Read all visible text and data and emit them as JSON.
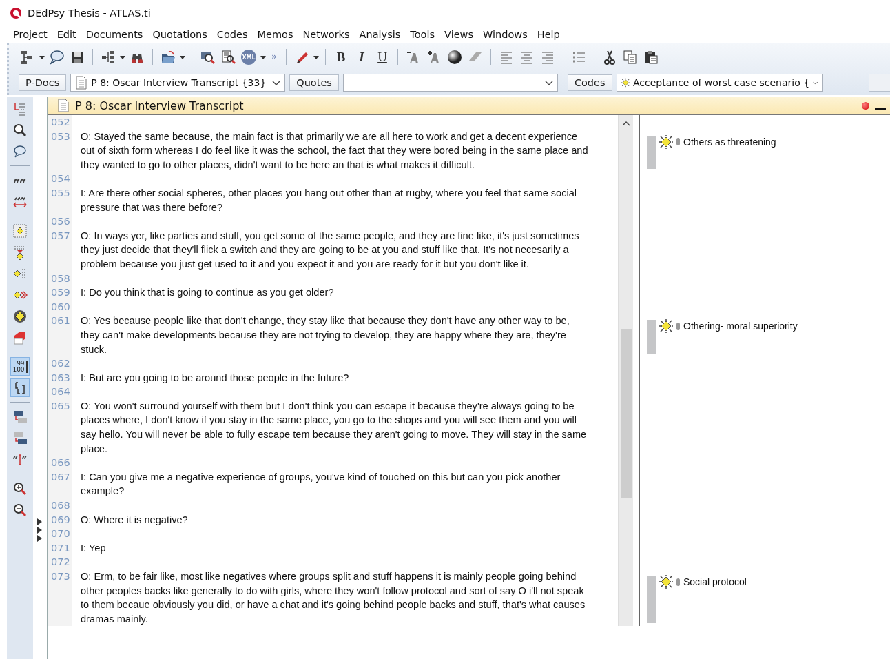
{
  "window": {
    "title": "DEdPsy Thesis - ATLAS.ti"
  },
  "menu": [
    "Project",
    "Edit",
    "Documents",
    "Quotations",
    "Codes",
    "Memos",
    "Networks",
    "Analysis",
    "Tools",
    "Views",
    "Windows",
    "Help"
  ],
  "toolbar": {
    "xml": "XML",
    "overflow": "»",
    "bold": "B",
    "italic": "I",
    "underline": "U"
  },
  "selectors": [
    {
      "kind": "button",
      "label": "P-Docs"
    },
    {
      "kind": "doc-combo",
      "value": "P 8: Oscar Interview Transcript {33}"
    },
    {
      "kind": "button",
      "label": "Quotes"
    },
    {
      "kind": "combo"
    },
    {
      "kind": "button",
      "label": "Codes"
    },
    {
      "kind": "code-combo",
      "value": "Acceptance of worst case scenario {"
    },
    {
      "kind": "stub"
    }
  ],
  "side_tools": [
    {
      "pressed": false
    },
    {
      "pressed": false
    },
    {
      "pressed": false
    },
    {
      "pressed": false
    },
    {
      "pressed": false
    },
    {
      "pressed": false
    },
    {
      "pressed": false
    },
    {
      "pressed": false
    },
    {
      "pressed": false
    },
    {
      "pressed": false
    },
    {
      "pressed": false
    },
    {
      "pressed": true,
      "label": [
        "99",
        "100"
      ]
    },
    {
      "pressed": true
    },
    {
      "pressed": false
    },
    {
      "pressed": false
    },
    {
      "pressed": false
    },
    {
      "pressed": false
    },
    {
      "pressed": false
    }
  ],
  "document": {
    "title": "P 8: Oscar Interview Transcript",
    "lines": [
      {
        "number": "052"
      },
      {
        "number": "053",
        "text": "O: Stayed the same because, the main fact is that primarily we are all here to work and get a decent experience out of sixth form whereas I do feel like it was the school, the fact that they were bored being in the same place and they wanted to go to other places, didn't want to be here an that is what makes it difficult.",
        "code": "Others as threatening"
      },
      {
        "number": "054"
      },
      {
        "number": "055",
        "text": "I: Are there other social spheres, other places you hang out other than at rugby, where you feel that same social pressure that was there before?"
      },
      {
        "number": "056"
      },
      {
        "number": "057",
        "text": "O: In ways yer, like parties and stuff, you get some of the same people, and they are fine like, it's just sometimes they just decide that they'll flick a switch and they are going to be at you and stuff like that. It's not necesarily a problem because you just get used to it and you expect it and you are ready for it but you don't like it."
      },
      {
        "number": "058"
      },
      {
        "number": "059",
        "text": "I: Do you think that is going to continue as you get older?"
      },
      {
        "number": "060"
      },
      {
        "number": "061",
        "text": "O: Yes because people like that don't change, they stay like that because they don't have any other way to be, they can't make developments because they are not trying to develop, they are happy where they are, they're stuck.",
        "code": "Othering- moral superiority"
      },
      {
        "number": "062"
      },
      {
        "number": "063",
        "text": "I: But are you going to be around those people in the future?"
      },
      {
        "number": "064"
      },
      {
        "number": "065",
        "text": "O: You won't surround yourself with them but I don't think you can escape it because they're always going to be places where, I don't know if you stay in the same place, you go to the shops and you will see them and you will say hello. You will never be able to fully escape tem because they aren't going to move. They will stay in the same place."
      },
      {
        "number": "066"
      },
      {
        "number": "067",
        "text": "I: Can you give me a negative experience of groups, you've kind of touched on this but can you pick another example?"
      },
      {
        "number": "068"
      },
      {
        "number": "069",
        "text": "O: Where it is negative?"
      },
      {
        "number": "070"
      },
      {
        "number": "071",
        "text": "I: Yep"
      },
      {
        "number": "072"
      },
      {
        "number": "073",
        "text": "O: Erm, to be fair like, most like negatives where groups split and stuff happens it is mainly people going behind other peoples backs like generally to do with girls, where they won't follow protocol and sort of say O i'll not speak to them becaue obviously you did, or have a chat and it's going behind people backs and stuff, that's what causes dramas mainly.",
        "code": "Social protocol"
      }
    ]
  }
}
